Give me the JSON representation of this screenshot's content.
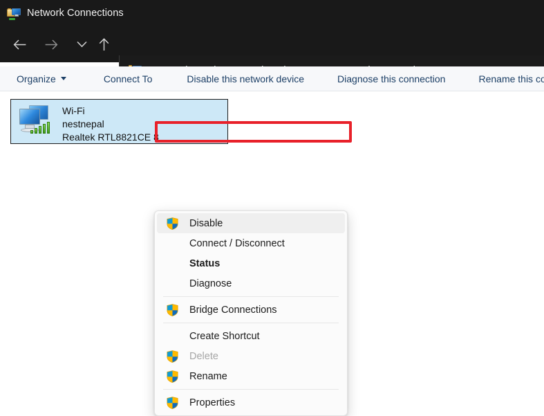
{
  "window": {
    "title": "Network Connections",
    "title_icon": "folder-network-icon"
  },
  "nav": {
    "back_icon": "arrow-left-icon",
    "forward_icon": "arrow-right-icon",
    "recent_icon": "chevron-down-icon",
    "up_icon": "arrow-up-icon",
    "address_icon": "folder-network-icon",
    "breadcrumbs": [
      "Control Panel",
      "Network and Internet",
      "Network Connections"
    ],
    "separator": "›"
  },
  "toolbar": {
    "items": [
      {
        "label": "Organize",
        "has_caret": true
      },
      {
        "label": "Connect To",
        "has_caret": false
      },
      {
        "label": "Disable this network device",
        "has_caret": false
      },
      {
        "label": "Diagnose this connection",
        "has_caret": false
      },
      {
        "label": "Rename this conne",
        "has_caret": false
      }
    ]
  },
  "connection": {
    "icon": "network-adapter-icon",
    "name": "Wi-Fi",
    "network": "nestnepal",
    "adapter": "Realtek RTL8821CE 8"
  },
  "context_menu": {
    "items": [
      {
        "label": "Disable",
        "shield": true,
        "bold": false,
        "disabled": false,
        "highlight": true,
        "separator_after": false
      },
      {
        "label": "Connect / Disconnect",
        "shield": false,
        "bold": false,
        "disabled": false,
        "highlight": false,
        "separator_after": false
      },
      {
        "label": "Status",
        "shield": false,
        "bold": true,
        "disabled": false,
        "highlight": false,
        "separator_after": false
      },
      {
        "label": "Diagnose",
        "shield": false,
        "bold": false,
        "disabled": false,
        "highlight": false,
        "separator_after": true
      },
      {
        "label": "Bridge Connections",
        "shield": true,
        "bold": false,
        "disabled": false,
        "highlight": false,
        "separator_after": true
      },
      {
        "label": "Create Shortcut",
        "shield": false,
        "bold": false,
        "disabled": false,
        "highlight": false,
        "separator_after": false
      },
      {
        "label": "Delete",
        "shield": true,
        "bold": false,
        "disabled": true,
        "highlight": false,
        "separator_after": false
      },
      {
        "label": "Rename",
        "shield": true,
        "bold": false,
        "disabled": false,
        "highlight": false,
        "separator_after": true
      },
      {
        "label": "Properties",
        "shield": true,
        "bold": false,
        "disabled": false,
        "highlight": false,
        "separator_after": false
      }
    ]
  },
  "annotation": {
    "type": "red-highlight-box",
    "target": "Disable",
    "color": "#e8212a"
  },
  "colors": {
    "titlebar_bg": "#191919",
    "toolbar_bg": "#f7f8fa",
    "toolbar_text": "#1c3f66",
    "selection_bg": "#cde8f7",
    "menu_bg": "#fbfbfb",
    "accent_red": "#e8212a"
  }
}
